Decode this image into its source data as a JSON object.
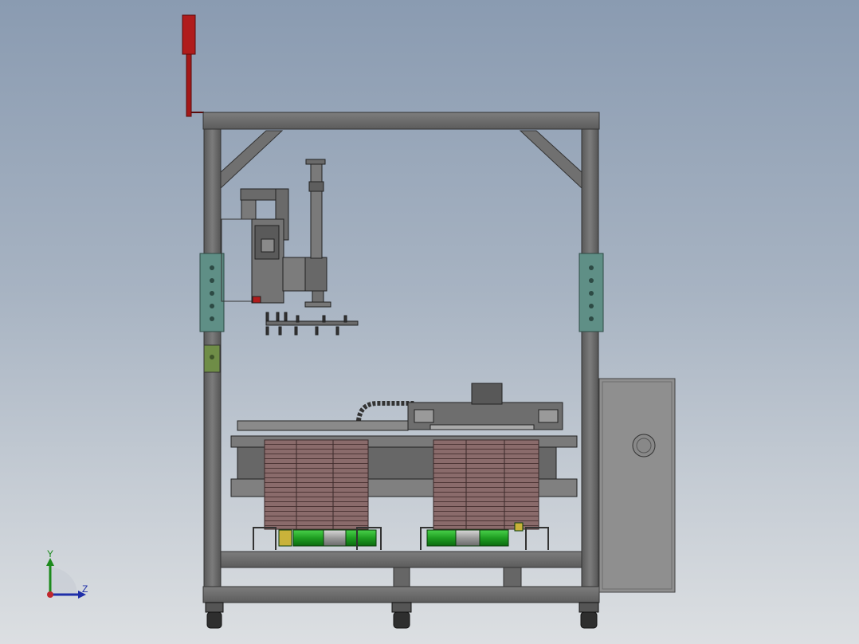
{
  "viewport": {
    "background_top": "#8a9bb1",
    "background_bottom": "#dcdfe2"
  },
  "model": {
    "frame_color": "#6e6e6e",
    "bracket_color": "#5f8f86",
    "cabinet_color": "#8e8e8e",
    "stack_color": "#7d5e5e",
    "roller_color": "#2fae2f",
    "beacon_color": "#b21d1d"
  },
  "triad": {
    "y_label": "Y",
    "z_label": "Z",
    "y_color": "#1c8a1c",
    "z_color": "#1f2fa8",
    "origin_color": "#c0272d"
  }
}
